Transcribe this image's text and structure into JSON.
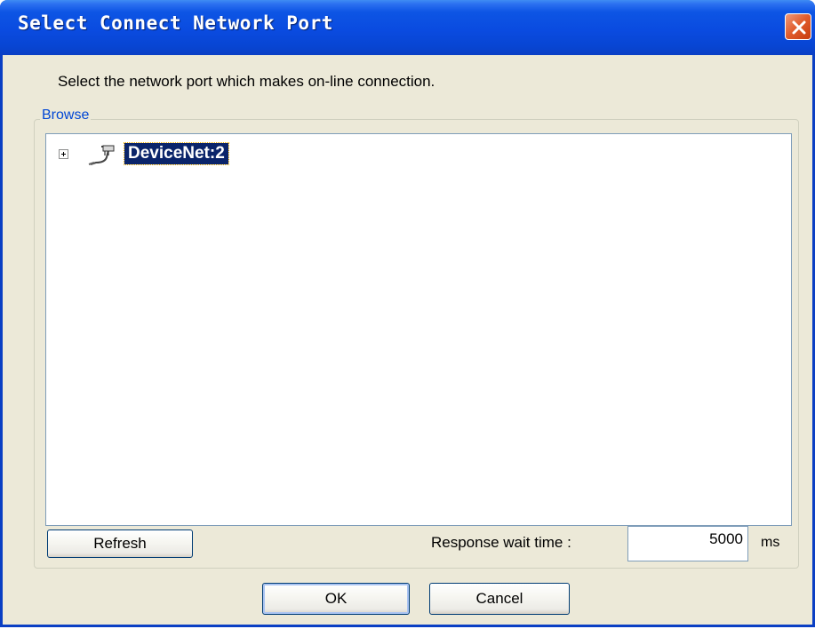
{
  "window": {
    "title": "Select Connect Network Port",
    "close_icon": "close-icon"
  },
  "instruction": "Select the network port which makes on-line connection.",
  "browse": {
    "label": "Browse",
    "tree": [
      {
        "label": "DeviceNet:2",
        "icon": "network-cable-icon",
        "expanded": false,
        "selected": true
      }
    ]
  },
  "controls": {
    "refresh_label": "Refresh",
    "wait_label": "Response wait time :",
    "wait_value": "5000",
    "wait_unit": "ms"
  },
  "buttons": {
    "ok_label": "OK",
    "cancel_label": "Cancel"
  },
  "colors": {
    "titlebar": "#0a4be0",
    "selection": "#0a246a",
    "dialog_bg": "#ece9d8"
  }
}
